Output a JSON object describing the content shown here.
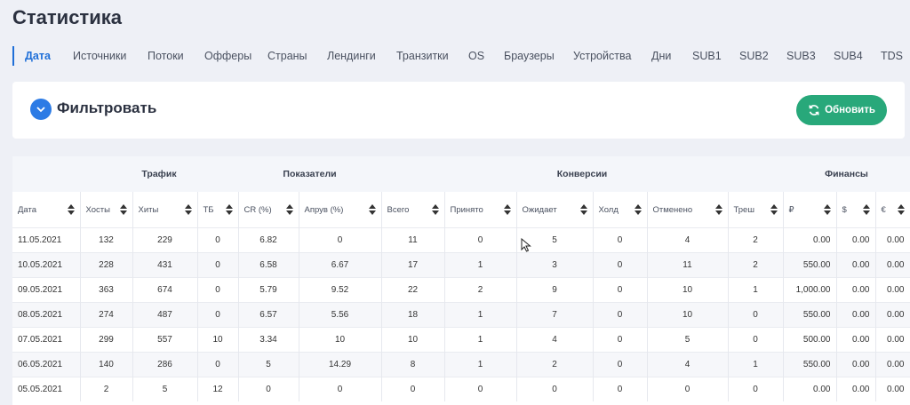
{
  "page": {
    "title": "Статистика"
  },
  "tabs": [
    {
      "label": "Дата",
      "active": true
    },
    {
      "label": "Источники"
    },
    {
      "label": "Потоки"
    },
    {
      "label": "Офферы"
    },
    {
      "label": "Страны"
    },
    {
      "label": "Лендинги"
    },
    {
      "label": "Транзитки"
    },
    {
      "label": "OS"
    },
    {
      "label": "Браузеры"
    },
    {
      "label": "Устройства"
    },
    {
      "label": "Дни"
    },
    {
      "label": "SUB1"
    },
    {
      "label": "SUB2"
    },
    {
      "label": "SUB3"
    },
    {
      "label": "SUB4"
    },
    {
      "label": "TDS"
    }
  ],
  "filter": {
    "label": "Фильтровать",
    "refresh_label": "Обновить"
  },
  "table": {
    "groups": [
      "Трафик",
      "Показатели",
      "Конверсии",
      "Финансы"
    ],
    "columns": [
      "Дата",
      "Хосты",
      "Хиты",
      "ТБ",
      "CR (%)",
      "Апрув (%)",
      "Всего",
      "Принято",
      "Ожидает",
      "Холд",
      "Отменено",
      "Треш",
      "₽",
      "$",
      "€"
    ],
    "rows": [
      [
        "11.05.2021",
        "132",
        "229",
        "0",
        "6.82",
        "0",
        "11",
        "0",
        "5",
        "0",
        "4",
        "2",
        "0.00",
        "0.00",
        "0.00"
      ],
      [
        "10.05.2021",
        "228",
        "431",
        "0",
        "6.58",
        "6.67",
        "17",
        "1",
        "3",
        "0",
        "11",
        "2",
        "550.00",
        "0.00",
        "0.00"
      ],
      [
        "09.05.2021",
        "363",
        "674",
        "0",
        "5.79",
        "9.52",
        "22",
        "2",
        "9",
        "0",
        "10",
        "1",
        "1,000.00",
        "0.00",
        "0.00"
      ],
      [
        "08.05.2021",
        "274",
        "487",
        "0",
        "6.57",
        "5.56",
        "18",
        "1",
        "7",
        "0",
        "10",
        "0",
        "550.00",
        "0.00",
        "0.00"
      ],
      [
        "07.05.2021",
        "299",
        "557",
        "10",
        "3.34",
        "10",
        "10",
        "1",
        "4",
        "0",
        "5",
        "0",
        "500.00",
        "0.00",
        "0.00"
      ],
      [
        "06.05.2021",
        "140",
        "286",
        "0",
        "5",
        "14.29",
        "8",
        "1",
        "2",
        "0",
        "4",
        "1",
        "550.00",
        "0.00",
        "0.00"
      ],
      [
        "05.05.2021",
        "2",
        "5",
        "12",
        "0",
        "0",
        "0",
        "0",
        "0",
        "0",
        "0",
        "0",
        "0.00",
        "0.00",
        "0.00"
      ]
    ]
  },
  "colors": {
    "accent": "#1f6fd8",
    "button": "#28a87a",
    "background": "#eef0f6"
  },
  "icons": {
    "filter_toggle": "chevron-down-icon",
    "refresh": "refresh-icon",
    "sort": "sort-icon"
  }
}
